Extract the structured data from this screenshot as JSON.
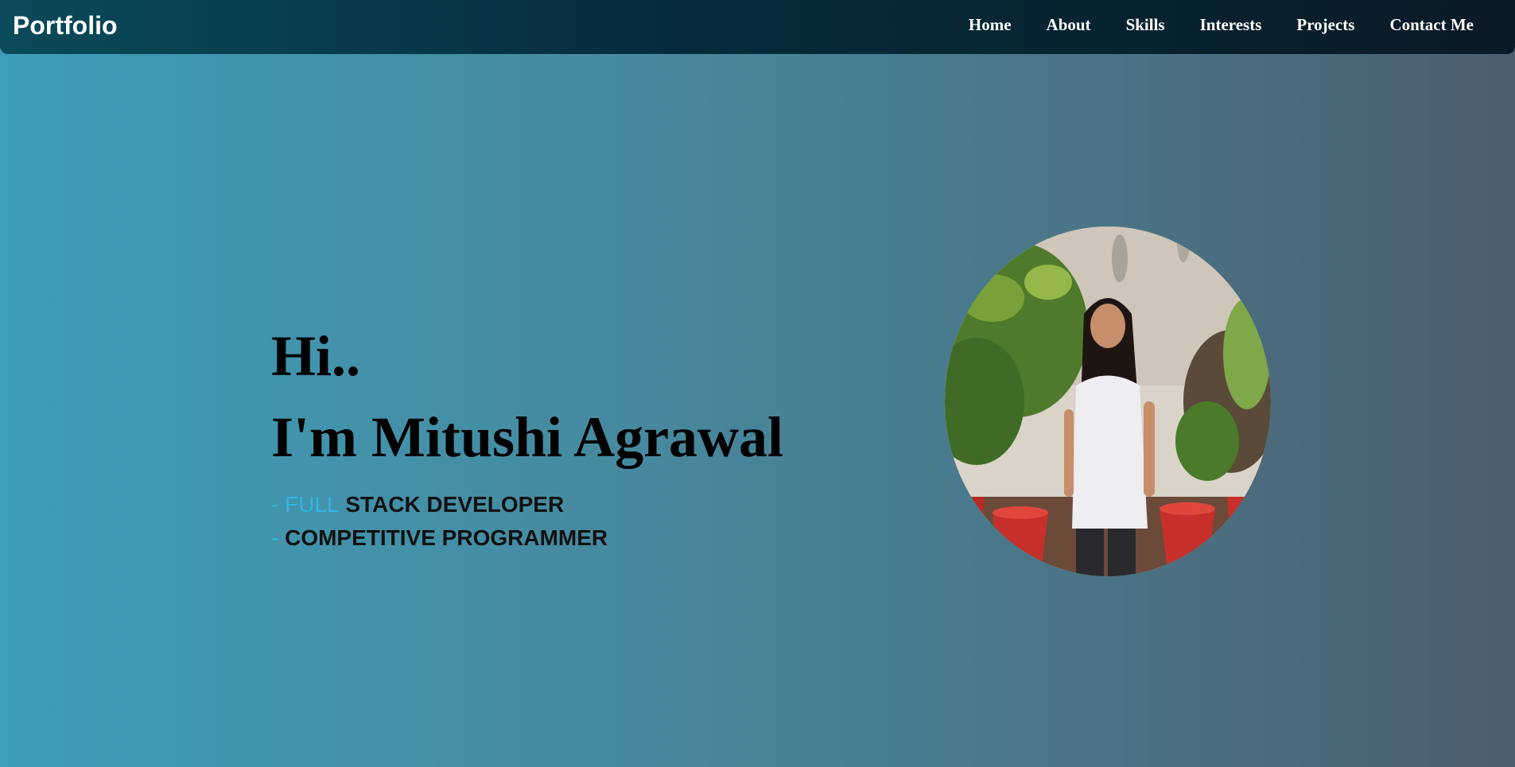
{
  "nav": {
    "brand": "Portfolio",
    "links": [
      "Home",
      "About",
      "Skills",
      "Interests",
      "Projects",
      "Contact Me"
    ]
  },
  "hero": {
    "greeting": "Hi..",
    "name": "I'm Mitushi Agrawal",
    "roles": [
      {
        "prefix": "- ",
        "accent": "FULL",
        "text": " STACK DEVELOPER"
      },
      {
        "prefix": "- ",
        "accent": "",
        "text": "COMPETITIVE PROGRAMMER"
      }
    ]
  },
  "colors": {
    "accent": "#34b5e3",
    "navbar": "#062c3b"
  }
}
